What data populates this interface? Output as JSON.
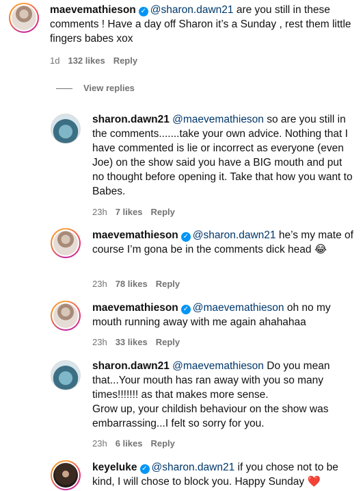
{
  "comments": [
    {
      "username": "maevemathieson",
      "verified": true,
      "mention": "@sharon.dawn21",
      "body": " are you still in these comments ! Have a day off Sharon it’s a Sunday , rest them little fingers babes xox",
      "time": "1d",
      "likes": "132 likes",
      "reply": "Reply"
    },
    {
      "username": "sharon.dawn21",
      "verified": false,
      "mention": "@maevemathieson",
      "body": " so are you still in the comments.......take your own advice. Nothing that I have commented is lie or incorrect as everyone (even Joe) on the show said you have a BIG mouth and put no thought before opening it. Take that how you want to Babes.",
      "time": "23h",
      "likes": "7 likes",
      "reply": "Reply"
    },
    {
      "username": "maevemathieson",
      "verified": true,
      "mention": "@sharon.dawn21",
      "body": " he’s my mate of course I’m gona be in the comments dick head",
      "emoji": "😂",
      "time": "23h",
      "likes": "78 likes",
      "reply": "Reply"
    },
    {
      "username": "maevemathieson",
      "verified": true,
      "mention": "@maevemathieson",
      "body": " oh no my mouth running away with me again ahahahaa",
      "time": "23h",
      "likes": "33 likes",
      "reply": "Reply"
    },
    {
      "username": "sharon.dawn21",
      "verified": false,
      "mention": "@maevemathieson",
      "body": " Do you mean that...Your mouth has ran away with you so many times!!!!!!! as that makes more sense.",
      "body2": "Grow up, your childish behaviour on the show was embarrassing...I felt so sorry for you.",
      "time": "23h",
      "likes": "6 likes",
      "reply": "Reply"
    },
    {
      "username": "keyeluke",
      "verified": true,
      "mention": "@sharon.dawn21",
      "body": " if you chose not to be kind, I will chose to block you. Happy Sunday ",
      "emoji": "❤️"
    }
  ],
  "view_replies": "View replies",
  "icons": {
    "verified": "verified-badge-icon",
    "colors": {
      "mention": "#00376b",
      "verified": "#0095f6",
      "meta": "#737373"
    }
  }
}
